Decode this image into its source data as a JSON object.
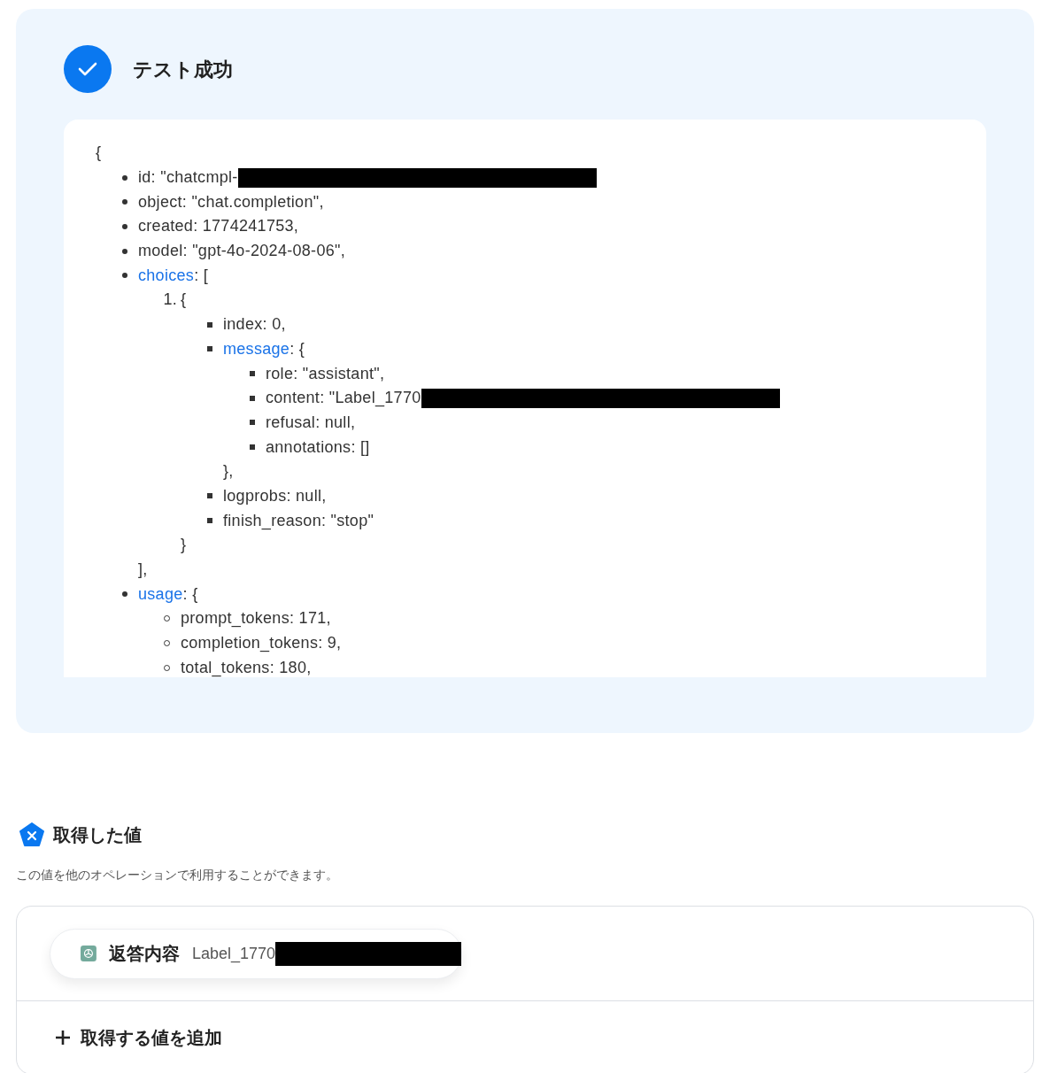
{
  "result": {
    "title": "テスト成功",
    "success": true,
    "output": {
      "open": "{",
      "items": [
        {
          "kind": "disc",
          "text": "id: \"chatcmpl-",
          "redacted": true
        },
        {
          "kind": "disc",
          "text": "object: \"chat.completion\","
        },
        {
          "kind": "disc",
          "text": "created: 1774241753,"
        },
        {
          "kind": "disc",
          "text": "model: \"gpt-4o-2024-08-06\","
        },
        {
          "kind": "disc",
          "link": "choices",
          "text": ": [",
          "close": "],",
          "children": [
            {
              "kind": "number",
              "marker": "1.",
              "text": "{",
              "close": "}",
              "children": [
                {
                  "kind": "square",
                  "text": "index: 0,"
                },
                {
                  "kind": "square",
                  "link": "message",
                  "text": ": {",
                  "close": "},",
                  "children": [
                    {
                      "kind": "square",
                      "text": "role: \"assistant\","
                    },
                    {
                      "kind": "square",
                      "text": "content: \"Label_1770",
                      "redacted": true
                    },
                    {
                      "kind": "square",
                      "text": "refusal: null,"
                    },
                    {
                      "kind": "square",
                      "text": "annotations: []"
                    }
                  ]
                },
                {
                  "kind": "square",
                  "text": "logprobs: null,"
                },
                {
                  "kind": "square",
                  "text": "finish_reason: \"stop\""
                }
              ]
            }
          ]
        },
        {
          "kind": "disc",
          "link": "usage",
          "text": ": {",
          "children": [
            {
              "kind": "circle",
              "text": "prompt_tokens: 171,"
            },
            {
              "kind": "circle",
              "text": "completion_tokens: 9,"
            },
            {
              "kind": "circle",
              "text": "total_tokens: 180,"
            }
          ]
        }
      ]
    }
  },
  "values": {
    "title": "取得した値",
    "description": "この値を他のオペレーションで利用することができます。",
    "items": [
      {
        "name": "返答内容",
        "value": "Label_1770",
        "redacted": true
      }
    ],
    "add_button": "取得する値を追加"
  }
}
